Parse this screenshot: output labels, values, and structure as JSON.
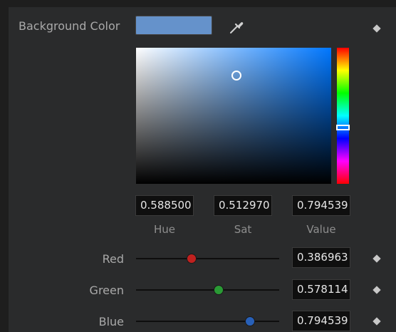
{
  "background_color": {
    "label": "Background Color",
    "swatch_color": "#6592cb",
    "picker_icon": "eyedropper-icon",
    "keyframe_icon": "diamond-icon"
  },
  "picker": {
    "hue_base": "#0077ff",
    "hue": 0.5885,
    "saturation": 0.51297,
    "value": 0.794539
  },
  "hsv_fields": {
    "hue": {
      "value": "0.588500",
      "label": "Hue"
    },
    "sat": {
      "value": "0.512970",
      "label": "Sat"
    },
    "val": {
      "value": "0.794539",
      "label": "Value"
    }
  },
  "rgb": [
    {
      "label": "Red",
      "value": "0.386963",
      "level": 0.386963,
      "knob_color": "#c0211f"
    },
    {
      "label": "Green",
      "value": "0.578114",
      "level": 0.578114,
      "knob_color": "#2a9a35"
    },
    {
      "label": "Blue",
      "value": "0.794539",
      "level": 0.794539,
      "knob_color": "#2860b8"
    }
  ]
}
